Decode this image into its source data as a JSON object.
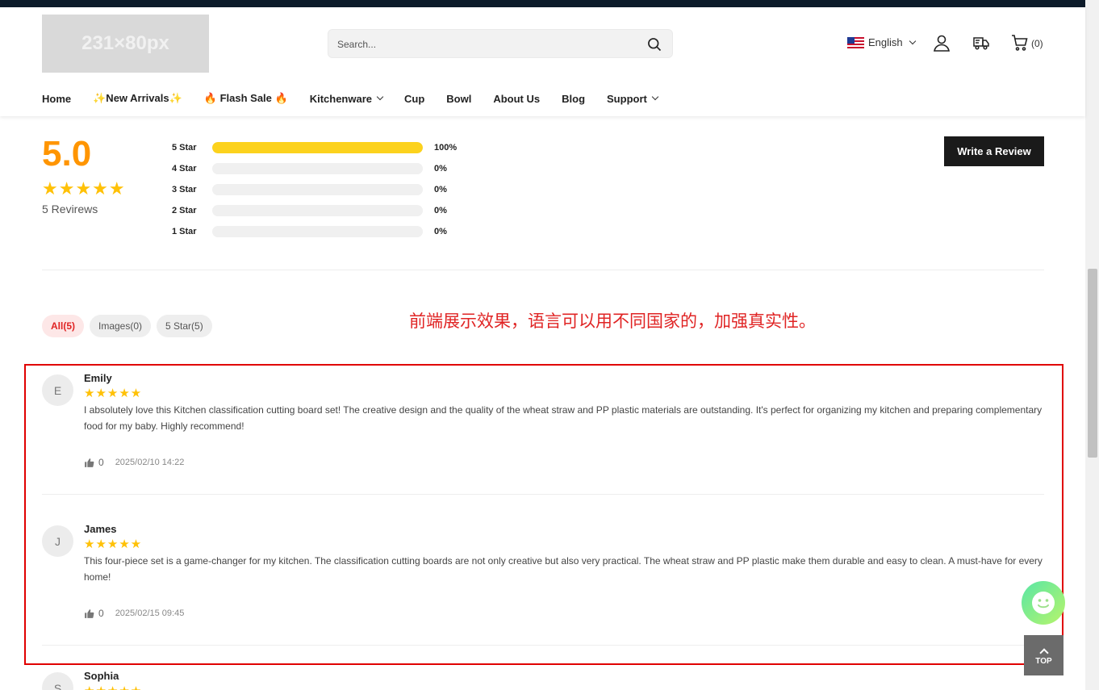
{
  "header": {
    "logo_text": "231×80px",
    "search_placeholder": "Search...",
    "language": "English",
    "cart_count": "(0)"
  },
  "nav": [
    {
      "label": "Home",
      "dropdown": false
    },
    {
      "label": "✨New Arrivals✨",
      "dropdown": false
    },
    {
      "label": "🔥 Flash Sale 🔥",
      "dropdown": false
    },
    {
      "label": "Kitchenware",
      "dropdown": true
    },
    {
      "label": "Cup",
      "dropdown": false
    },
    {
      "label": "Bowl",
      "dropdown": false
    },
    {
      "label": "About Us",
      "dropdown": false
    },
    {
      "label": "Blog",
      "dropdown": false
    },
    {
      "label": "Support",
      "dropdown": true
    }
  ],
  "summary": {
    "score": "5.0",
    "stars": "★★★★★",
    "count_text": "5 Revirews",
    "write_review": "Write a Review"
  },
  "distribution": [
    {
      "label": "5 Star",
      "pct": "100%",
      "fill": 1.0
    },
    {
      "label": "4 Star",
      "pct": "0%",
      "fill": 0
    },
    {
      "label": "3 Star",
      "pct": "0%",
      "fill": 0
    },
    {
      "label": "2 Star",
      "pct": "0%",
      "fill": 0
    },
    {
      "label": "1 Star",
      "pct": "0%",
      "fill": 0
    }
  ],
  "filters": [
    {
      "label": "All(5)",
      "active": true
    },
    {
      "label": "Images(0)",
      "active": false
    },
    {
      "label": "5 Star(5)",
      "active": false
    }
  ],
  "annotation": "前端展示效果，语言可以用不同国家的，加强真实性。",
  "reviews": [
    {
      "initial": "E",
      "name": "Emily",
      "stars": "★★★★★",
      "text": "I absolutely love this Kitchen classification cutting board set! The creative design and the quality of the wheat straw and PP plastic materials are outstanding. It's perfect for organizing my kitchen and preparing complementary food for my baby. Highly recommend!",
      "likes": "0",
      "date": "2025/02/10 14:22"
    },
    {
      "initial": "J",
      "name": "James",
      "stars": "★★★★★",
      "text": "This four-piece set is a game-changer for my kitchen. The classification cutting boards are not only creative but also very practical. The wheat straw and PP plastic make them durable and easy to clean. A must-have for every home!",
      "likes": "0",
      "date": "2025/02/15 09:45"
    },
    {
      "initial": "S",
      "name": "Sophia",
      "stars": "★★★★★"
    }
  ],
  "floating": {
    "top_label": "TOP"
  },
  "colors": {
    "accent_orange": "#ff9500",
    "star_yellow": "#ffc107",
    "bar_yellow": "#fcd21d",
    "annotation_red": "#e02424"
  }
}
